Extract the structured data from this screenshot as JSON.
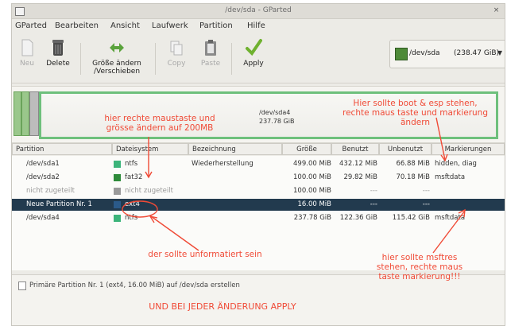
{
  "window": {
    "title": "/dev/sda - GParted"
  },
  "menu": [
    "GParted",
    "Bearbeiten",
    "Ansicht",
    "Laufwerk",
    "Partition",
    "Hilfe"
  ],
  "toolbar": {
    "new": "Neu",
    "delete": "Delete",
    "resize_line1": "Größe ändern",
    "resize_line2": "/Verschieben",
    "copy": "Copy",
    "paste": "Paste",
    "apply": "Apply"
  },
  "device_selector": {
    "name": "/dev/sda",
    "size": "(238.47 GiB)"
  },
  "graph": {
    "label_name": "/dev/sda4",
    "label_size": "237.78 GiB"
  },
  "columns": [
    "Partition",
    "Dateisystem",
    "Bezeichnung",
    "Größe",
    "Benutzt",
    "Unbenutzt",
    "Markierungen"
  ],
  "rows": [
    {
      "partition": "/dev/sda1",
      "fs": "ntfs",
      "label": "Wiederherstellung",
      "size": "499.00 MiB",
      "used": "432.12 MiB",
      "unused": "66.88 MiB",
      "flags": "hidden, diag",
      "color": "#3cb47a"
    },
    {
      "partition": "/dev/sda2",
      "fs": "fat32",
      "label": "",
      "size": "100.00 MiB",
      "used": "29.82 MiB",
      "unused": "70.18 MiB",
      "flags": "msftdata",
      "color": "#2e8b3a"
    },
    {
      "partition": "nicht zugeteilt",
      "fs": "nicht zugeteilt",
      "label": "",
      "size": "100.00 MiB",
      "used": "---",
      "unused": "---",
      "flags": "",
      "color": "#9a9a9a"
    },
    {
      "partition": "Neue Partition Nr. 1",
      "fs": "ext4",
      "label": "",
      "size": "16.00 MiB",
      "used": "---",
      "unused": "---",
      "flags": "",
      "color": "#2b5a8a"
    },
    {
      "partition": "/dev/sda4",
      "fs": "ntfs",
      "label": "",
      "size": "237.78 GiB",
      "used": "122.36 GiB",
      "unused": "115.42 GiB",
      "flags": "msftdata",
      "color": "#3cb47a"
    }
  ],
  "operations": {
    "item": "Primäre Partition Nr. 1 (ext4, 16.00 MiB) auf /dev/sda erstellen"
  },
  "annotations": {
    "a1_line1": "hier rechte maustaste und",
    "a1_line2": "grösse ändern auf 200MB",
    "a2_line1": "Hier sollte boot & esp stehen,",
    "a2_line2": "rechte maus taste und markierung",
    "a2_line3": "ändern",
    "a3": "der sollte unformatiert sein",
    "a4_line1": "hier sollte msftres",
    "a4_line2": "stehen, rechte maus",
    "a4_line3": "taste markierung!!!",
    "a5": "UND BEI JEDER ÄNDERUNG APPLY"
  },
  "colors": {
    "annotation": "#f04a36",
    "selected_row": "#223a4e",
    "partition_border": "#6ec07c"
  }
}
